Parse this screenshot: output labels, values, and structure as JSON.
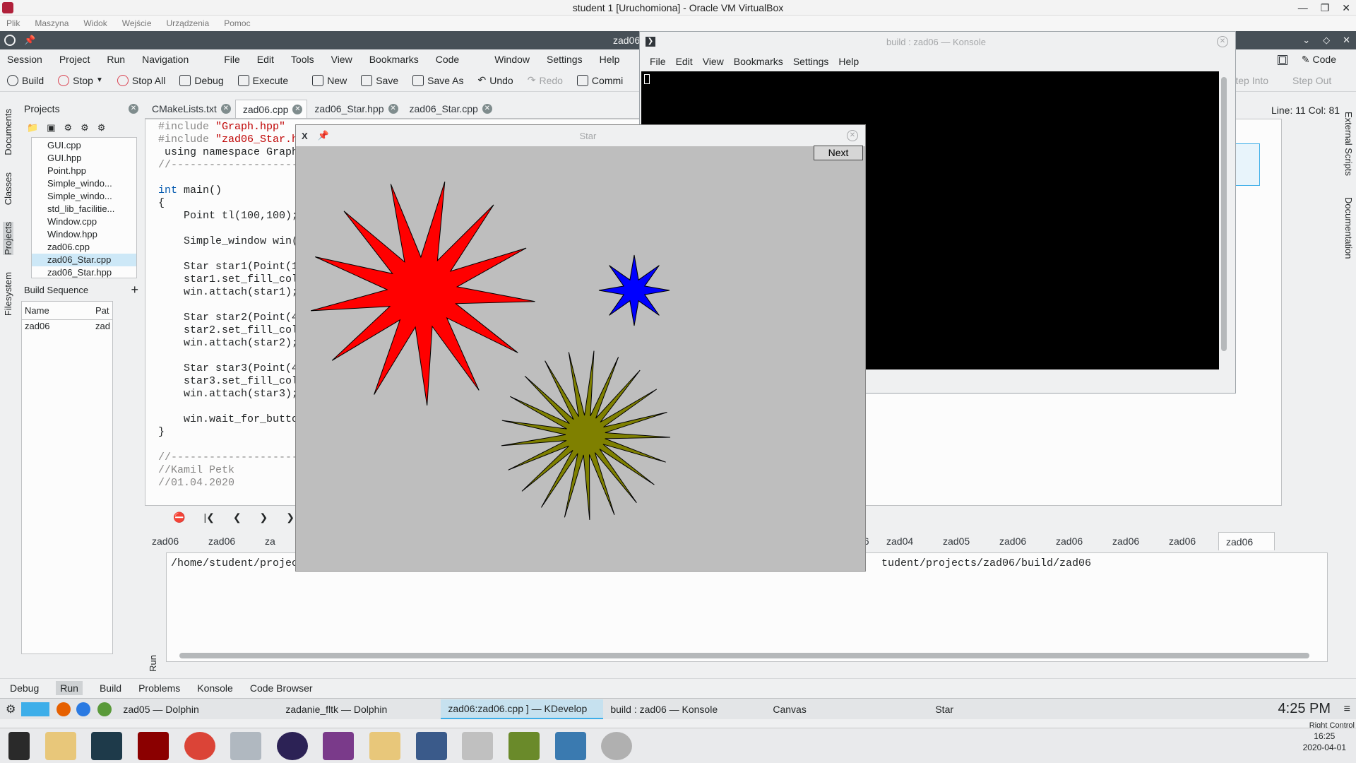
{
  "vbox": {
    "title": "student 1 [Uruchomiona] - Oracle VM VirtualBox",
    "menu": [
      "Plik",
      "Maszyna",
      "Widok",
      "Wejście",
      "Urządzenia",
      "Pomoc"
    ]
  },
  "kdevelop": {
    "title": "zad06",
    "menu": [
      "Session",
      "Project",
      "Run",
      "Navigation",
      "File",
      "Edit",
      "Tools",
      "View",
      "Bookmarks",
      "Code",
      "Window",
      "Settings",
      "Help"
    ],
    "code_button": "Code",
    "toolbar": {
      "build": "Build",
      "stop": "Stop",
      "stop_all": "Stop All",
      "debug": "Debug",
      "execute": "Execute",
      "new": "New",
      "save": "Save",
      "save_as": "Save As",
      "undo": "Undo",
      "redo": "Redo",
      "commit": "Commi",
      "step_into": "Step Into",
      "step_out": "Step Out"
    },
    "left_dock": [
      "Documents",
      "Classes",
      "Projects",
      "Filesystem"
    ],
    "right_dock": [
      "External Scripts",
      "Documentation"
    ],
    "projects": {
      "title": "Projects",
      "files": [
        "GUI.cpp",
        "GUI.hpp",
        "Point.hpp",
        "Simple_windo...",
        "Simple_windo...",
        "std_lib_facilitie...",
        "Window.cpp",
        "Window.hpp",
        "zad06.cpp",
        "zad06_Star.cpp",
        "zad06_Star.hpp"
      ],
      "selected_index": 9,
      "build_sequence": "Build Sequence",
      "cols": [
        "Name",
        "Pat"
      ],
      "row": {
        "name": "zad06",
        "path": "zad"
      }
    },
    "editor": {
      "tabs": [
        "CMakeLists.txt",
        "zad06.cpp",
        "zad06_Star.hpp",
        "zad06_Star.cpp"
      ],
      "active_tab": 1,
      "cursor": "Line: 11 Col: 81",
      "lines": {
        "l1a": "#include ",
        "l1b": "\"Graph.hpp\"",
        "l2a": "#include ",
        "l2b": "\"zad06_Star.h",
        "l3": " using namespace Graph",
        "l4": "//---------------------",
        "l5a": "int",
        "l5b": " main()",
        "l6": "{",
        "l7": "    Point tl(100,100);",
        "l8": "    Simple_window win(",
        "l9": "    Star star1(Point(1",
        "l10": "    star1.set_fill_col",
        "l11": "    win.attach(star1);",
        "l12": "    Star star2(Point(4",
        "l13": "    star2.set_fill_col",
        "l14": "    win.attach(star2);",
        "l15": "    Star star3(Point(4",
        "l16": "    star3.set_fill_col",
        "l17": "    win.attach(star3);",
        "l18": "    win.wait_for_butto",
        "l19": "}",
        "l20": "//---------------------",
        "l21": "//Kamil Petk",
        "l22": "//01.04.2020"
      }
    },
    "output": {
      "tabs_left": [
        "zad06",
        "zad06",
        "za"
      ],
      "tabs_right": [
        "06",
        "zad04",
        "zad05",
        "zad06",
        "zad06",
        "zad06",
        "zad06",
        "zad06"
      ],
      "line_left": "/home/student/projec",
      "line_right": "tudent/projects/zad06/build/zad06",
      "run_label": "Run"
    },
    "bottom_tabs": [
      "Debug",
      "Run",
      "Build",
      "Problems",
      "Konsole",
      "Code Browser"
    ],
    "active_bottom": "Run"
  },
  "konsole": {
    "title": "build : zad06 — Konsole",
    "menu": [
      "File",
      "Edit",
      "View",
      "Bookmarks",
      "Settings",
      "Help"
    ]
  },
  "star_window": {
    "title": "Star",
    "next": "Next",
    "colors": {
      "star1": "#ff0000",
      "star2": "#0000ff",
      "star3": "#7f8000"
    }
  },
  "kde_panel": {
    "tasks": [
      "zad05 — Dolphin",
      "zadanie_fltk — Dolphin",
      "zad06:zad06.cpp ] — KDevelop",
      "build : zad06 — Konsole",
      "Canvas",
      "Star"
    ],
    "clock": "4:25 PM",
    "right_control": "Right Control"
  },
  "windows": {
    "time": "16:25",
    "date": "2020-04-01"
  }
}
